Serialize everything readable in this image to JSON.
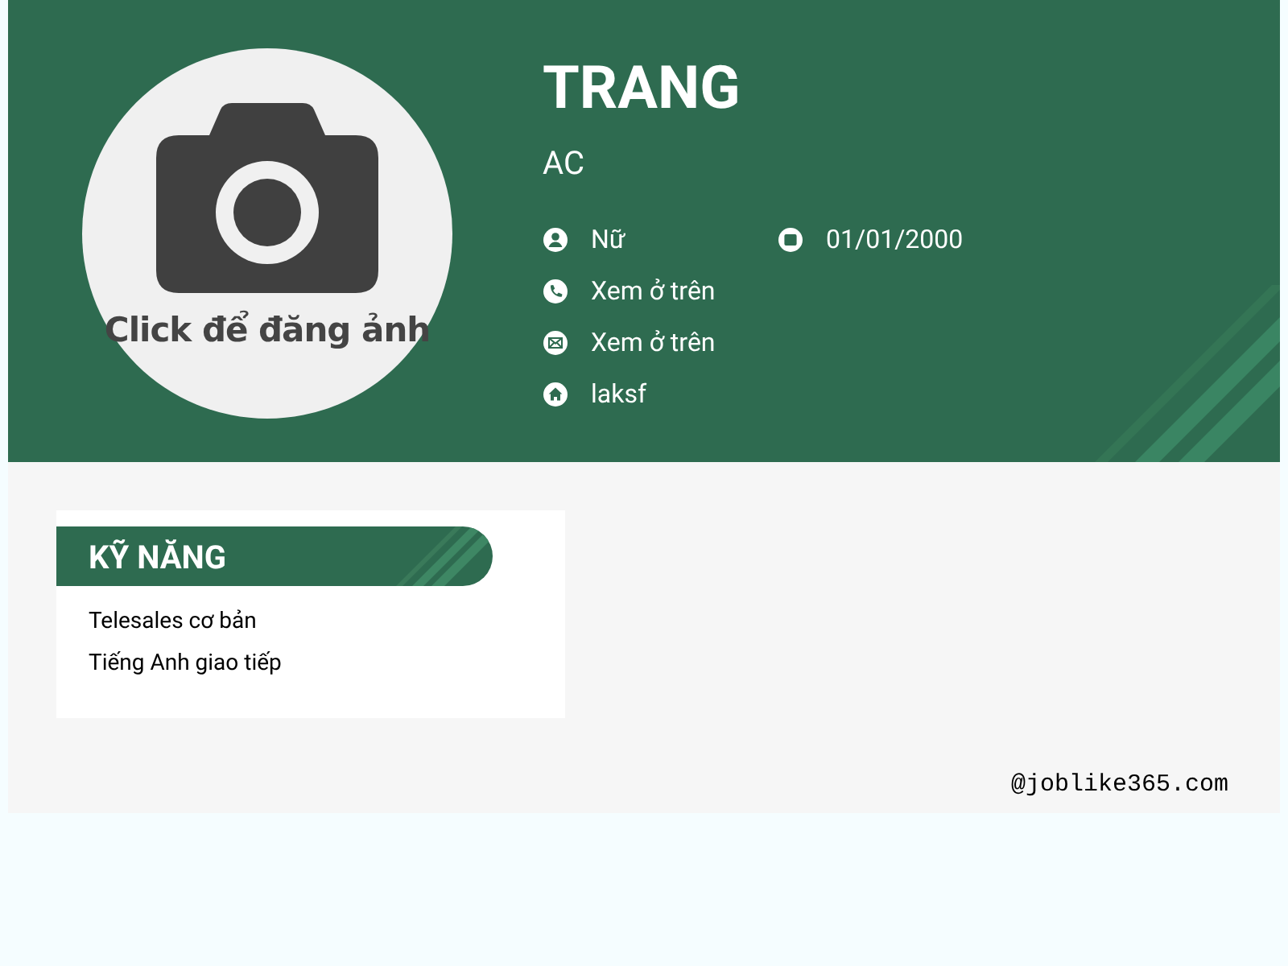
{
  "profile": {
    "photo_hint": "Click để đăng ảnh",
    "name": "TRANG",
    "position": "AC"
  },
  "info_rows": [
    [
      {
        "kind": "gender",
        "text": "Nữ"
      },
      {
        "kind": "birthday",
        "text": "01/01/2000"
      }
    ],
    [
      {
        "kind": "phone",
        "text": "Xem ở trên"
      }
    ],
    [
      {
        "kind": "email",
        "text": "Xem ở trên"
      }
    ],
    [
      {
        "kind": "address",
        "text": "laksf"
      }
    ]
  ],
  "skills": {
    "title": "KỸ NĂNG",
    "items": [
      "Telesales cơ bản",
      "Tiếng Anh giao tiếp"
    ]
  },
  "footer": "@joblike365.com"
}
